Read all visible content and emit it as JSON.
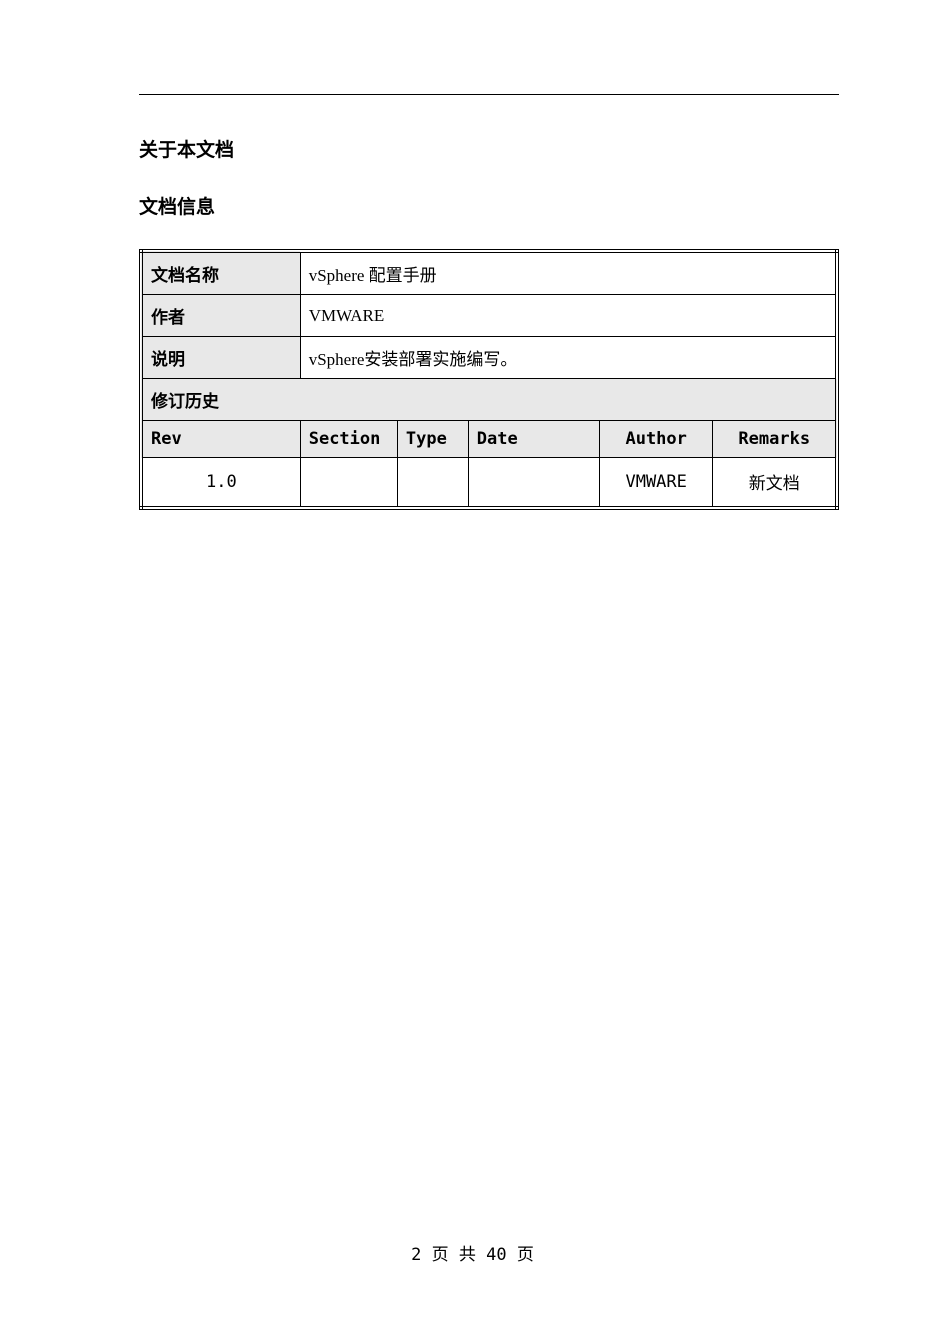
{
  "headings": {
    "about": "关于本文档",
    "docinfo": "文档信息"
  },
  "info": {
    "name_label": "文档名称",
    "name_value": "vSphere 配置手册",
    "author_label": "作者",
    "author_value": "VMWARE",
    "desc_label": "说明",
    "desc_value": "vSphere安装部署实施编写。"
  },
  "revision": {
    "header": "修订历史",
    "cols": {
      "rev": "Rev",
      "section": "Section",
      "type": "Type",
      "date": "Date",
      "author": "Author",
      "remarks": "Remarks"
    },
    "rows": [
      {
        "rev": "1.0",
        "section": "",
        "type": "",
        "date": "",
        "author": "VMWARE",
        "remarks": "新文档"
      }
    ]
  },
  "footer": "2 页 共 40 页"
}
